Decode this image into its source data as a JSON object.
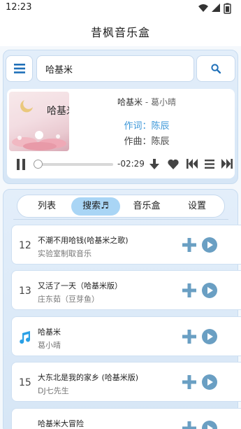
{
  "status": {
    "time": "12:23"
  },
  "app": {
    "title": "昔枫音乐盒"
  },
  "search": {
    "query": "哈基米"
  },
  "player": {
    "cover_text": "哈基米",
    "song": "哈基米",
    "separator": " - ",
    "artist": "葛小晴",
    "lyricist": "作词：陈辰",
    "composer": "作曲：陈辰",
    "time_remaining": "-02:29",
    "progress": 0.0
  },
  "tabs": [
    {
      "label": "列表"
    },
    {
      "label": "搜索♬",
      "active": true
    },
    {
      "label": "音乐盒"
    },
    {
      "label": "设置"
    }
  ],
  "results": [
    {
      "index": "12",
      "title": "不潮不用哈钱(哈基米之歌)",
      "artist": "实验室制取音乐",
      "playing": false
    },
    {
      "index": "13",
      "title": "又活了一天（哈基米版）",
      "artist": "庄东茹（豆芽鱼）",
      "playing": false
    },
    {
      "index": "",
      "title": "哈基米",
      "artist": "葛小晴",
      "playing": true
    },
    {
      "index": "15",
      "title": "大东北是我的家乡 (哈基米版)",
      "artist": "DJ七先生",
      "playing": false
    },
    {
      "index": "",
      "title": "哈基米大冒险",
      "artist": "",
      "playing": false
    }
  ],
  "colors": {
    "accent": "#1e6fb8",
    "play_circle": "#6a9fc3",
    "add": "#6a9fc3",
    "lyric": "#3a96d8",
    "tab_active": "#a9d5f5"
  },
  "icons": {
    "menu": "menu-icon",
    "search": "search-icon",
    "pause": "pause-icon",
    "download": "download-icon",
    "favorite": "heart-icon",
    "previous": "skip-previous-icon",
    "playlist": "playlist-icon",
    "next": "skip-next-icon",
    "add": "add-icon",
    "play": "play-circle-icon",
    "now_playing": "music-note-icon"
  }
}
